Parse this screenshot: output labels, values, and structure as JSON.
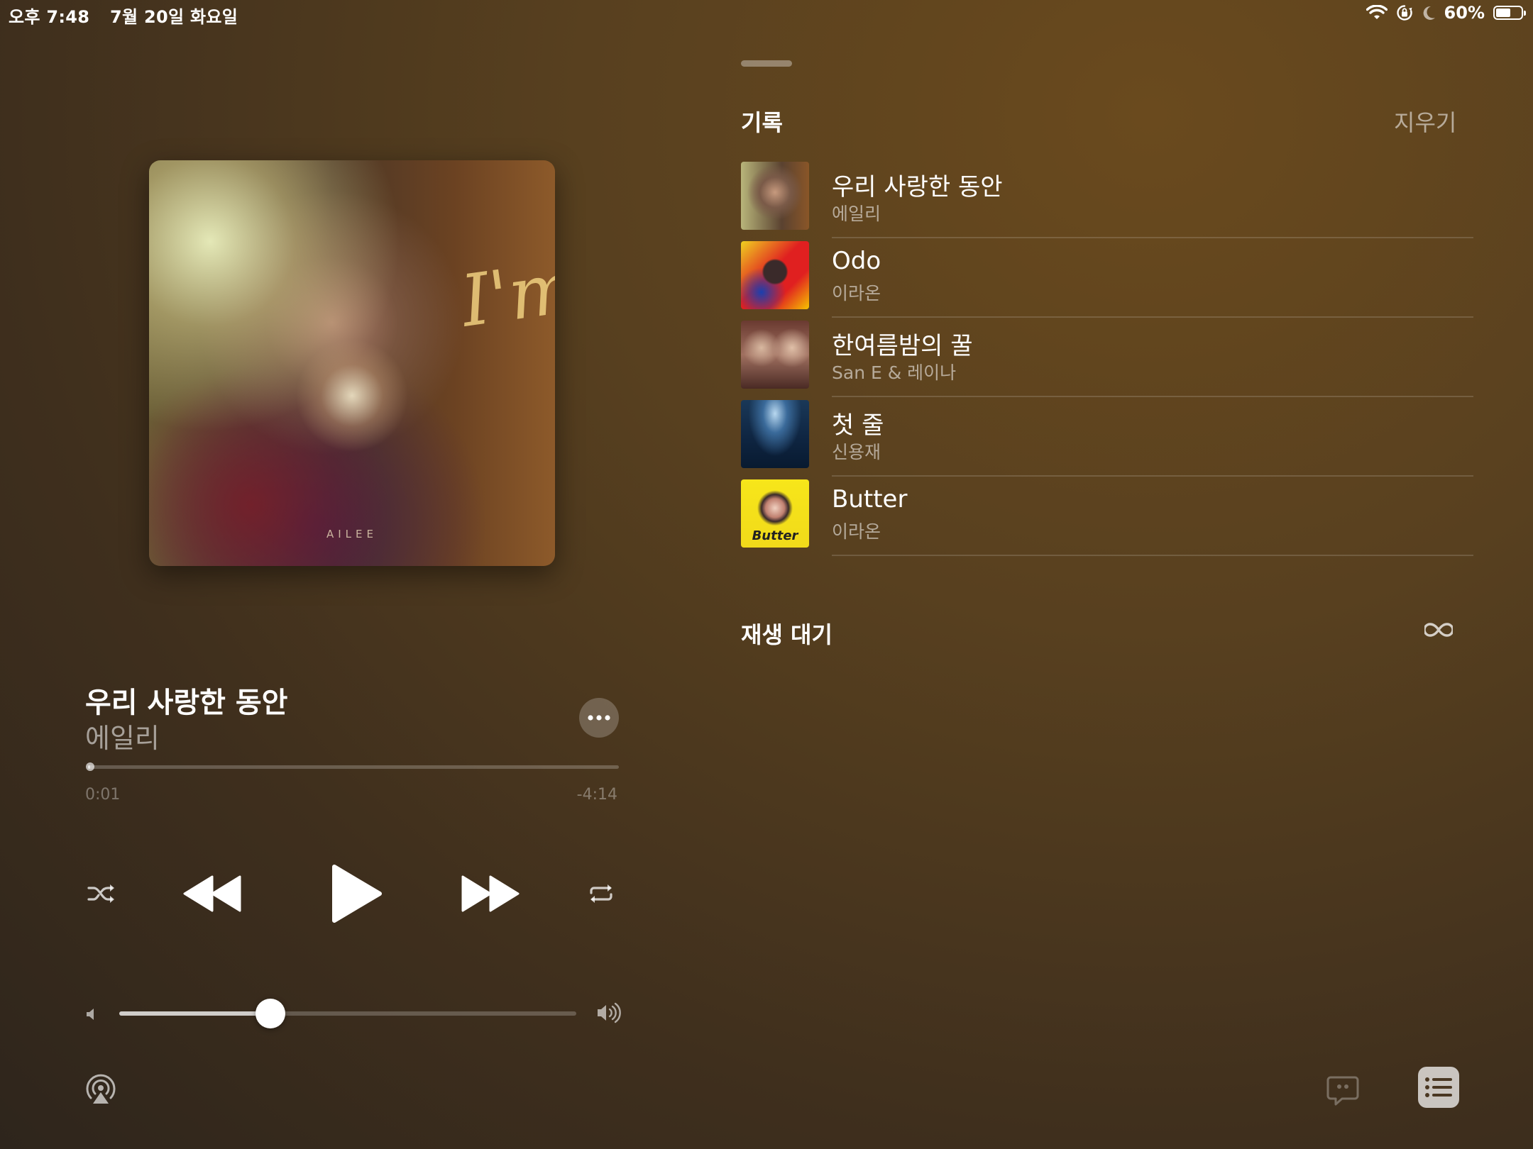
{
  "status_bar": {
    "time": "오후 7:48",
    "date": "7월 20일 화요일",
    "battery_percent": "60%",
    "battery_level": 0.6
  },
  "album": {
    "script_text": "I'm",
    "artist_text": "AILEE"
  },
  "now_playing": {
    "title": "우리 사랑한 동안",
    "artist": "에일리",
    "elapsed": "0:01",
    "remaining": "-4:14",
    "progress": 0.004,
    "volume": 0.33
  },
  "history": {
    "heading": "기록",
    "clear_label": "지우기",
    "items": [
      {
        "title": "우리 사랑한 동안",
        "artist": "에일리"
      },
      {
        "title": "Odo",
        "artist": "이라온"
      },
      {
        "title": "한여름밤의 꿀",
        "artist": "San E & 레이나"
      },
      {
        "title": "첫 줄",
        "artist": "신용재"
      },
      {
        "title": "Butter",
        "artist": "이라온"
      }
    ],
    "thumb_texts": [
      "",
      "",
      "",
      "",
      "Butter"
    ]
  },
  "queue": {
    "heading": "재생 대기"
  },
  "colors": {
    "background": "#58401f",
    "accent": "#ffffff"
  }
}
